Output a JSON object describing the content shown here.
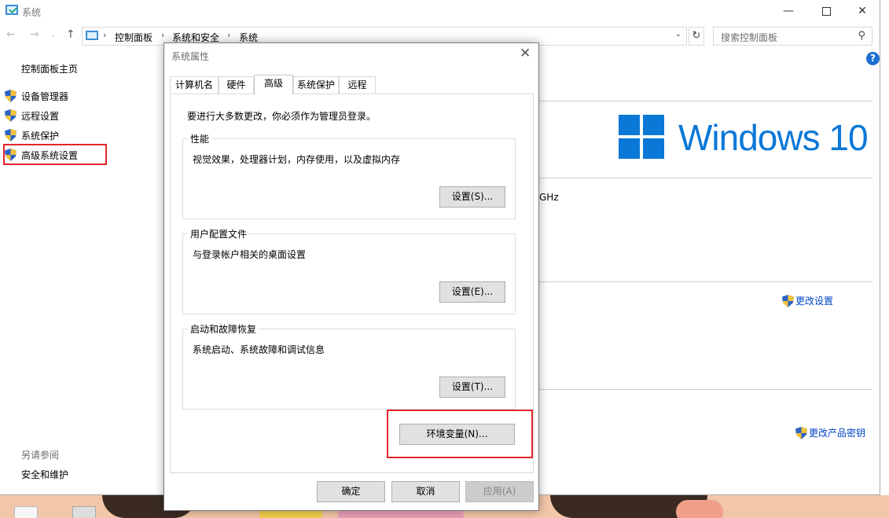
{
  "window": {
    "title": "系统",
    "min_glyph": "—",
    "close_glyph": "✕"
  },
  "address_bar": {
    "crumbs": [
      "控制面板",
      "系统和安全",
      "系统"
    ],
    "separator": "›",
    "search_placeholder": "搜索控制面板"
  },
  "left_nav": {
    "home": "控制面板主页",
    "items": [
      {
        "label": "设备管理器"
      },
      {
        "label": "远程设置"
      },
      {
        "label": "系统保护"
      },
      {
        "label": "高级系统设置"
      }
    ],
    "see_also": "另请参阅",
    "see_also_items": [
      "安全和维护"
    ]
  },
  "content": {
    "windows_brand": "Windows 10",
    "processor_fragment": "GHz",
    "change_settings": "更改设置",
    "change_product_key": "更改产品密钥"
  },
  "dialog": {
    "title": "系统属性",
    "tabs": [
      "计算机名",
      "硬件",
      "高级",
      "系统保护",
      "远程"
    ],
    "active_tab": "高级",
    "admin_note": "要进行大多数更改，你必须作为管理员登录。",
    "groups": [
      {
        "legend": "性能",
        "desc": "视觉效果，处理器计划，内存使用，以及虚拟内存",
        "button": "设置(S)..."
      },
      {
        "legend": "用户配置文件",
        "desc": "与登录帐户相关的桌面设置",
        "button": "设置(E)..."
      },
      {
        "legend": "启动和故障恢复",
        "desc": "系统启动、系统故障和调试信息",
        "button": "设置(T)..."
      }
    ],
    "env_button": "环境变量(N)...",
    "ok": "确定",
    "cancel": "取消",
    "apply": "应用(A)"
  },
  "colors": {
    "highlight": "#e0262c",
    "link": "#0046c8",
    "windows_blue": "#0a78d7"
  },
  "icons": {
    "shield": "uac-shield-icon",
    "help": "help-icon",
    "search": "search-icon"
  }
}
